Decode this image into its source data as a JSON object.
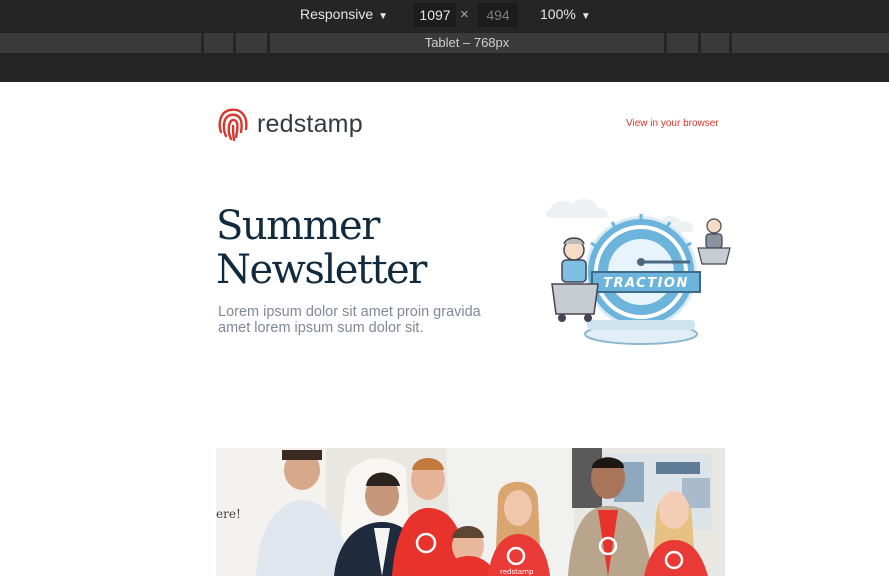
{
  "toolbar": {
    "device": "Responsive",
    "width": "1097",
    "times_symbol": "×",
    "height": "494",
    "zoom": "100%",
    "breakpoint_label": "Tablet – 768px",
    "caret": "▼"
  },
  "header": {
    "brand": "redstamp",
    "view_in_browser": "View in your browser"
  },
  "hero": {
    "title_line1": "Summer",
    "title_line2": "Newsletter",
    "subtitle": "Lorem ipsum dolor sit amet proin gravida amet lorem ipsum sum dolor sit.",
    "illustration_text": "TRACTION"
  },
  "photo": {
    "sign_text": "ere!",
    "shirt_text": "redstamp"
  },
  "colors": {
    "brand_red": "#d8372d",
    "title_navy": "#122a3e",
    "muted_text": "#7e8996",
    "toolbar_bg": "#252525"
  }
}
